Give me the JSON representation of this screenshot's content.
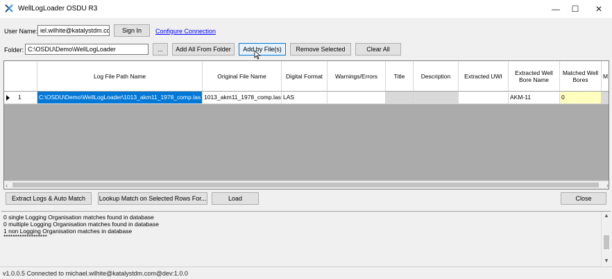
{
  "window": {
    "title": "WellLogLoader OSDU R3",
    "icon": "app-logo-icon",
    "minimize_glyph": "—",
    "maximize_glyph": "☐",
    "close_glyph": "✕"
  },
  "user": {
    "label": "User Name:",
    "value": "iel.wilhite@katalystdm.com",
    "sign_in_label": "Sign In",
    "configure_link": "Configure Connection"
  },
  "folder": {
    "label": "Folder:",
    "value": "C:\\OSDU\\Demo\\WellLogLoader",
    "browse_label": "...",
    "add_all_label": "Add All From Folder",
    "add_by_files_label": "Add by File(s)",
    "remove_selected_label": "Remove Selected",
    "clear_all_label": "Clear All"
  },
  "grid": {
    "columns": [
      "",
      "Log File Path Name",
      "Original File Name",
      "Digital Format",
      "Warnings/Errors",
      "Title",
      "Description",
      "Extracted UWI",
      "Extracted Well Bore Name",
      "Matched Well Bores",
      "M"
    ],
    "rows": [
      {
        "index": "1",
        "path": "C:\\OSDU\\Demo\\WellLogLoader\\1013_akm11_1978_comp.las",
        "original_name": "1013_akm11_1978_comp.las",
        "format": "LAS",
        "warnings": "",
        "title": "",
        "description": "",
        "uwi": "",
        "well_bore_name": "AKM-11",
        "matched": "0"
      }
    ]
  },
  "actions": {
    "extract_label": "Extract Logs & Auto Match",
    "lookup_label": "Lookup Match on Selected Rows For...",
    "load_label": "Load",
    "close_label": "Close"
  },
  "log": {
    "lines": [
      "0 single Logging Organisation matches found in database",
      "0 multiple Logging Organisation matches found in database",
      "1 non Logging Organisation matches in database",
      "*******************"
    ]
  },
  "status": {
    "text": "v1.0.0.5   Connected to michael.wilhite@katalystdm.com@dev:1.0.0"
  },
  "colors": {
    "selection": "#0078d7",
    "link": "#0000ff",
    "highlight_yellow": "#ffffc0"
  }
}
